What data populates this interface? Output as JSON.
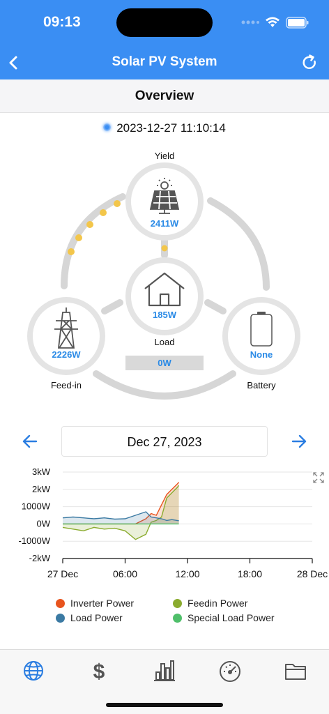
{
  "status_bar": {
    "time": "09:13"
  },
  "nav": {
    "title": "Solar PV System",
    "back_icon": "chevron-left-icon",
    "refresh_icon": "refresh-icon"
  },
  "overview": {
    "title": "Overview"
  },
  "timestamp": "2023-12-27 11:10:14",
  "yield": {
    "label": "Yield",
    "value": "2411W",
    "icon": "solar-panel-icon"
  },
  "load": {
    "label": "Load",
    "value": "185W",
    "icon": "house-icon",
    "bar_value": "0W"
  },
  "feed_in": {
    "label": "Feed-in",
    "value": "2226W",
    "icon": "power-tower-icon"
  },
  "battery": {
    "label": "Battery",
    "value": "None",
    "icon": "battery-icon"
  },
  "date_nav": {
    "date": "Dec 27, 2023",
    "prev_icon": "arrow-left-icon",
    "next_icon": "arrow-right-icon"
  },
  "chart_data": {
    "type": "line",
    "title": "",
    "y_ticks": [
      "3kW",
      "2kW",
      "1000W",
      "0W",
      "-1000W",
      "-2kW"
    ],
    "x_ticks": [
      "27 Dec",
      "06:00",
      "12:00",
      "18:00",
      "28 Dec"
    ],
    "ylim": [
      -2000,
      3000
    ],
    "grid": true,
    "legend_position": "bottom",
    "x": [
      "00:00",
      "01:00",
      "02:00",
      "03:00",
      "04:00",
      "05:00",
      "06:00",
      "07:00",
      "08:00",
      "08:30",
      "09:00",
      "09:30",
      "10:00",
      "10:30",
      "11:00",
      "11:10"
    ],
    "series": [
      {
        "name": "Inverter Power",
        "color": "#e8541e",
        "values": [
          0,
          0,
          0,
          0,
          0,
          0,
          0,
          0,
          300,
          600,
          500,
          1100,
          1700,
          2000,
          2300,
          2411
        ]
      },
      {
        "name": "Feedin Power",
        "color": "#8aab2e",
        "values": [
          -200,
          -300,
          -400,
          -200,
          -300,
          -250,
          -400,
          -900,
          -600,
          100,
          200,
          400,
          1500,
          1800,
          2100,
          2226
        ]
      },
      {
        "name": "Load Power",
        "color": "#3b7aa3",
        "values": [
          350,
          400,
          350,
          300,
          350,
          280,
          300,
          500,
          700,
          400,
          350,
          300,
          200,
          250,
          200,
          185
        ]
      },
      {
        "name": "Special Load Power",
        "color": "#4fbf6a",
        "values": [
          0,
          0,
          0,
          0,
          0,
          0,
          0,
          0,
          0,
          0,
          0,
          0,
          0,
          0,
          0,
          0
        ]
      }
    ]
  },
  "tabs": [
    {
      "name": "tab-overview",
      "icon": "globe-icon",
      "active": true
    },
    {
      "name": "tab-earnings",
      "icon": "dollar-icon",
      "active": false
    },
    {
      "name": "tab-statistics",
      "icon": "bar-chart-icon",
      "active": false
    },
    {
      "name": "tab-gauge",
      "icon": "speedometer-icon",
      "active": false
    },
    {
      "name": "tab-files",
      "icon": "folder-icon",
      "active": false
    }
  ]
}
